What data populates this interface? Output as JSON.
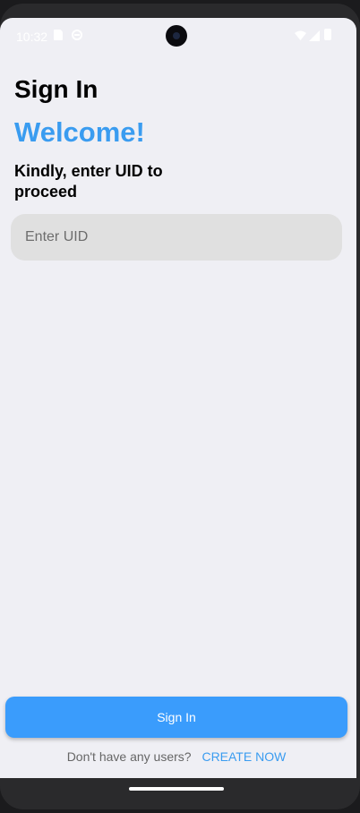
{
  "status_bar": {
    "time": "10:32",
    "icons": [
      "sim-card-icon",
      "do-not-disturb-icon",
      "wifi-icon",
      "cellular-signal-icon",
      "battery-icon"
    ]
  },
  "page": {
    "title": "Sign In",
    "welcome": "Welcome!",
    "prompt": "Kindly, enter UID to proceed"
  },
  "uid_input": {
    "placeholder": "Enter UID",
    "value": ""
  },
  "sign_in_button": {
    "label": "Sign In"
  },
  "footer": {
    "question": "Don't have any users?",
    "link": "CREATE NOW"
  },
  "colors": {
    "accent": "#3a9cf0",
    "button": "#3a9cfc",
    "background": "#efeff4",
    "input_background": "#e0e0e0"
  }
}
